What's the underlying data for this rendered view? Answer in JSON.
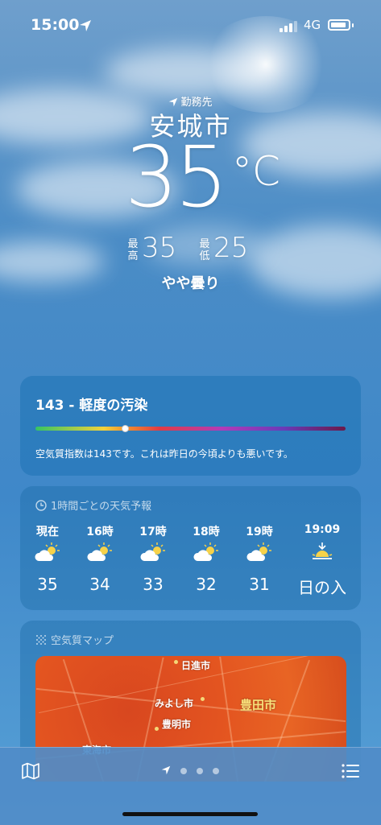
{
  "status_bar": {
    "time": "15:00",
    "network": "4G"
  },
  "location": {
    "tag": "勤務先",
    "city": "安城市",
    "temperature": "35",
    "unit": "°C",
    "high_label": "最高",
    "high": "35",
    "low_label": "最低",
    "low": "25",
    "condition": "やや曇り"
  },
  "air_quality": {
    "title": "143 - 軽度の汚染",
    "index": 143,
    "description": "空気質指数は143です。これは昨日の今頃よりも悪いです。",
    "scale_colors": [
      "#35c463",
      "#f3d23a",
      "#f08a2e",
      "#e33b44",
      "#b23bb8",
      "#6a3ab8",
      "#6b1a4a"
    ]
  },
  "hourly": {
    "header": "1時間ごとの天気予報",
    "items": [
      {
        "label": "現在",
        "icon": "partly-sunny-icon",
        "value": "35"
      },
      {
        "label": "16時",
        "icon": "partly-sunny-icon",
        "value": "34"
      },
      {
        "label": "17時",
        "icon": "partly-sunny-icon",
        "value": "33"
      },
      {
        "label": "18時",
        "icon": "partly-sunny-icon",
        "value": "32"
      },
      {
        "label": "19時",
        "icon": "partly-sunny-icon",
        "value": "31"
      },
      {
        "label": "19:09",
        "icon": "sunset-icon",
        "value": "日の入"
      }
    ]
  },
  "aq_map": {
    "header": "空気質マップ",
    "places": {
      "nisshin": "日進市",
      "miyoshi": "みよし市",
      "toyota": "豊田市",
      "toyoake": "豊明市",
      "tokai": "東海市"
    }
  }
}
